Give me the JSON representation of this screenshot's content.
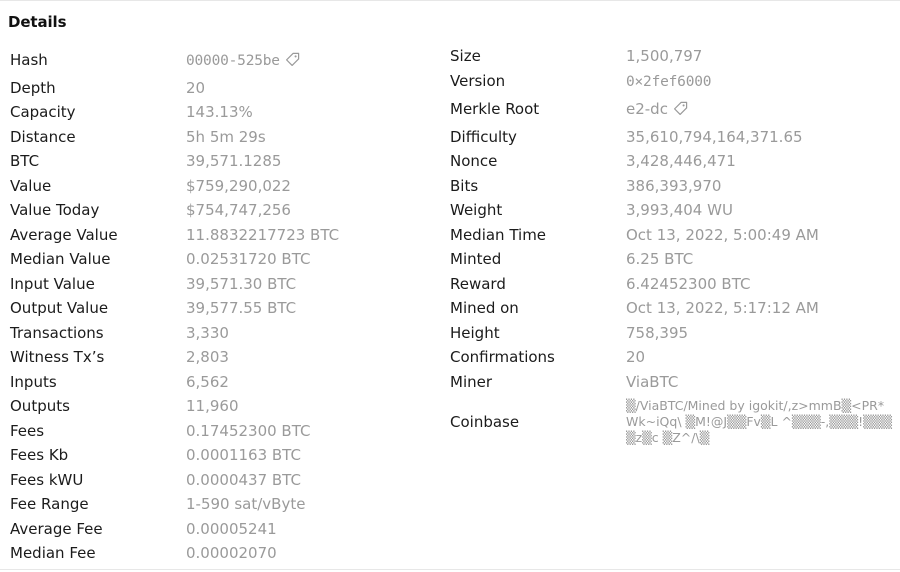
{
  "title": "Details",
  "icons": {
    "tag": "tag-icon"
  },
  "left": [
    {
      "id": "hash",
      "label": "Hash",
      "value": "00000-525be",
      "mono": true,
      "tag": true
    },
    {
      "id": "depth",
      "label": "Depth",
      "value": "20",
      "mono": false
    },
    {
      "id": "capacity",
      "label": "Capacity",
      "value": "143.13%",
      "mono": false
    },
    {
      "id": "distance",
      "label": "Distance",
      "value": "5h 5m 29s",
      "mono": false
    },
    {
      "id": "btc",
      "label": "BTC",
      "value": "39,571.1285",
      "mono": false
    },
    {
      "id": "value",
      "label": "Value",
      "value": "$759,290,022",
      "mono": false
    },
    {
      "id": "value-today",
      "label": "Value Today",
      "value": "$754,747,256",
      "mono": false
    },
    {
      "id": "average-value",
      "label": "Average Value",
      "value": "11.8832217723 BTC",
      "mono": false
    },
    {
      "id": "median-value",
      "label": "Median Value",
      "value": "0.02531720 BTC",
      "mono": false
    },
    {
      "id": "input-value",
      "label": "Input Value",
      "value": "39,571.30 BTC",
      "mono": false
    },
    {
      "id": "output-value",
      "label": "Output Value",
      "value": "39,577.55 BTC",
      "mono": false
    },
    {
      "id": "transactions",
      "label": "Transactions",
      "value": "3,330",
      "mono": false
    },
    {
      "id": "witness-txs",
      "label": "Witness Tx’s",
      "value": "2,803",
      "mono": false
    },
    {
      "id": "inputs",
      "label": "Inputs",
      "value": "6,562",
      "mono": false
    },
    {
      "id": "outputs",
      "label": "Outputs",
      "value": "11,960",
      "mono": false
    },
    {
      "id": "fees",
      "label": "Fees",
      "value": "0.17452300 BTC",
      "mono": false
    },
    {
      "id": "fees-kb",
      "label": "Fees Kb",
      "value": "0.0001163 BTC",
      "mono": false
    },
    {
      "id": "fees-kwu",
      "label": "Fees kWU",
      "value": "0.0000437 BTC",
      "mono": false
    },
    {
      "id": "fee-range",
      "label": "Fee Range",
      "value": "1-590 sat/vByte",
      "mono": false
    },
    {
      "id": "average-fee",
      "label": "Average Fee",
      "value": "0.00005241",
      "mono": false
    },
    {
      "id": "median-fee",
      "label": "Median Fee",
      "value": "0.00002070",
      "mono": false
    }
  ],
  "right": [
    {
      "id": "size",
      "label": "Size",
      "value": "1,500,797",
      "mono": false
    },
    {
      "id": "version",
      "label": "Version",
      "value": "0×2fef6000",
      "mono": true
    },
    {
      "id": "merkle-root",
      "label": "Merkle Root",
      "value": "e2-dc",
      "mono": false,
      "tag": true
    },
    {
      "id": "difficulty",
      "label": "Difficulty",
      "value": "35,610,794,164,371.65",
      "mono": false
    },
    {
      "id": "nonce",
      "label": "Nonce",
      "value": "3,428,446,471",
      "mono": false
    },
    {
      "id": "bits",
      "label": "Bits",
      "value": "386,393,970",
      "mono": false
    },
    {
      "id": "weight",
      "label": "Weight",
      "value": "3,993,404 WU",
      "mono": false
    },
    {
      "id": "median-time",
      "label": "Median Time",
      "value": "Oct 13, 2022, 5:00:49 AM",
      "mono": false
    },
    {
      "id": "minted",
      "label": "Minted",
      "value": "6.25 BTC",
      "mono": false
    },
    {
      "id": "reward",
      "label": "Reward",
      "value": "6.42452300 BTC",
      "mono": false
    },
    {
      "id": "mined-on",
      "label": "Mined on",
      "value": "Oct 13, 2022, 5:17:12 AM",
      "mono": false
    },
    {
      "id": "height",
      "label": "Height",
      "value": "758,395",
      "mono": false
    },
    {
      "id": "confirmations",
      "label": "Confirmations",
      "value": "20",
      "mono": false
    },
    {
      "id": "miner",
      "label": "Miner",
      "value": "ViaBTC",
      "mono": false
    },
    {
      "id": "coinbase",
      "label": "Coinbase",
      "value": "▒/ViaBTC/Mined by igokit/,z>mmB▒<PR*Wk~iQq\\ ▒M!@J▒▒Fv▒L ^▒▒▒-,▒▒▒!▒▒▒▒z▒c ▒Z^/\\▒",
      "mono": false,
      "multiline": true
    }
  ]
}
